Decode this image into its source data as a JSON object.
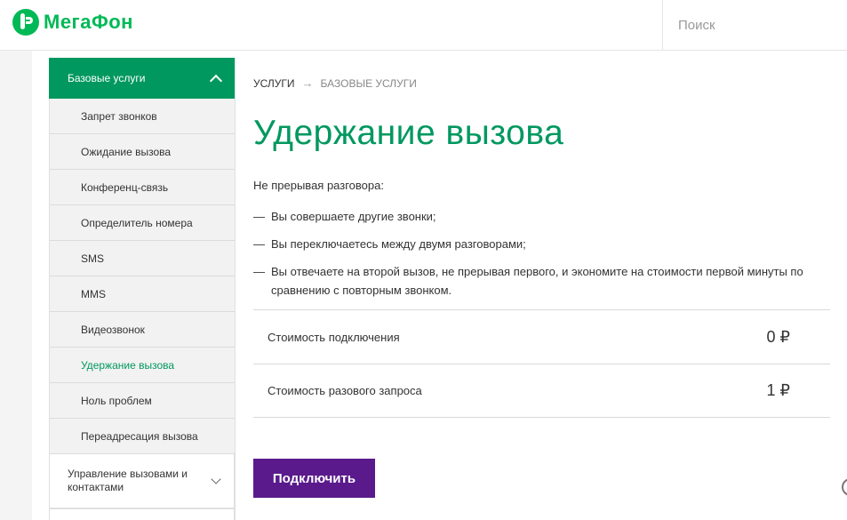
{
  "header": {
    "logo_text": "МегаФон",
    "search_placeholder": "Поиск"
  },
  "sidebar": {
    "section_title": "Базовые услуги",
    "items": [
      {
        "label": "Запрет звонков"
      },
      {
        "label": "Ожидание вызова"
      },
      {
        "label": "Конференц-связь"
      },
      {
        "label": "Определитель номера"
      },
      {
        "label": "SMS"
      },
      {
        "label": "MMS"
      },
      {
        "label": "Видеозвонок"
      },
      {
        "label": "Удержание вызова",
        "active": true
      },
      {
        "label": "Ноль проблем"
      },
      {
        "label": "Переадресация вызова"
      }
    ],
    "group_title": "Управление вызовами и контактами"
  },
  "breadcrumb": {
    "root": "УСЛУГИ",
    "separator": "→",
    "current": "БАЗОВЫЕ УСЛУГИ"
  },
  "main": {
    "title": "Удержание вызова",
    "intro": "Не прерывая разговора:",
    "bullets": [
      "Вы совершаете другие звонки;",
      "Вы переключаетесь между двумя разговорами;",
      "Вы отвечаете на второй вызов, не прерывая первого, и экономите на стоимости первой минуты по сравнению с повторным звонком."
    ],
    "bullet_marker": "—",
    "prices": [
      {
        "label": "Стоимость подключения",
        "value": "0 ₽"
      },
      {
        "label": "Стоимость разового запроса",
        "value": "1 ₽"
      }
    ],
    "connect_label": "Подключить"
  },
  "colors": {
    "brand_green": "#00985f",
    "logo_green": "#00b956",
    "button_purple": "#5a1a8c"
  }
}
